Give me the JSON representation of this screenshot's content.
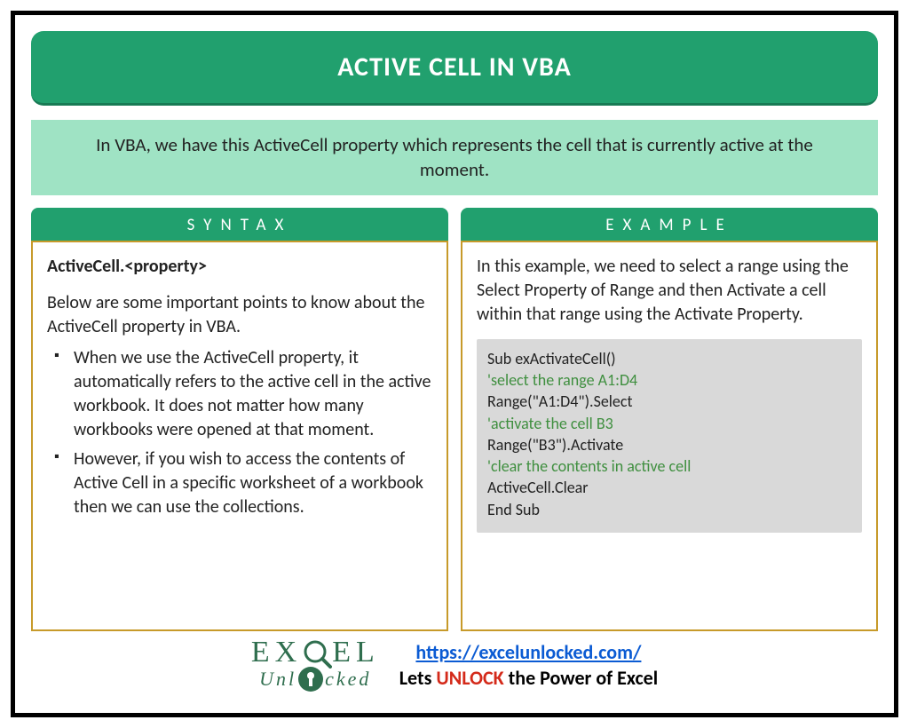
{
  "title": "ACTIVE CELL IN VBA",
  "intro": "In VBA, we have this ActiveCell property which represents the cell that is currently active at the moment.",
  "left": {
    "header": "SYNTAX",
    "signature": "ActiveCell.<property>",
    "lead": "Below are some important points to know about the ActiveCell property in VBA.",
    "points": [
      "When we use the ActiveCell property, it automatically refers to the active cell in the active workbook. It does not matter how many workbooks were opened at that moment.",
      "However, if you wish to access the contents of Active Cell in a specific worksheet of a workbook then we can use the collections."
    ]
  },
  "right": {
    "header": "EXAMPLE",
    "lead": "In this example, we need to select a range using the Select Property of Range and then Activate a cell within that range using the Activate Property.",
    "code": [
      {
        "t": "Sub exActivateCell()",
        "c": false
      },
      {
        "t": "'select the range A1:D4",
        "c": true
      },
      {
        "t": "Range(\"A1:D4\").Select",
        "c": false
      },
      {
        "t": "'activate the cell B3",
        "c": true
      },
      {
        "t": "Range(\"B3\").Activate",
        "c": false
      },
      {
        "t": "'clear the contents in active cell",
        "c": true
      },
      {
        "t": "ActiveCell.Clear",
        "c": false
      },
      {
        "t": "End Sub",
        "c": false
      }
    ]
  },
  "footer": {
    "logo_top_left": "EX",
    "logo_top_right": "EL",
    "logo_bottom_left": "Unl",
    "logo_bottom_right": "cked",
    "link": "https://excelunlocked.com/",
    "tag_before": "Lets ",
    "tag_unlock": "UNLOCK",
    "tag_after": " the Power of Excel"
  }
}
